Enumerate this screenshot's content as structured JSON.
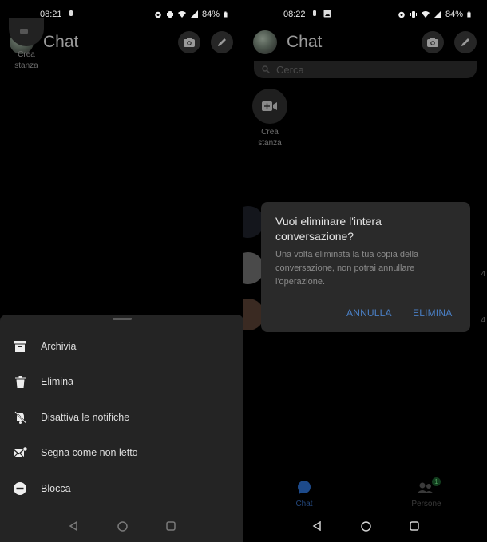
{
  "left_screen": {
    "status_bar": {
      "time": "08:21",
      "battery": "84%"
    },
    "header": {
      "title": "Chat"
    },
    "create_room": {
      "line1": "Crea",
      "line2": "stanza"
    },
    "sheet": {
      "items": [
        {
          "label": "Archivia",
          "icon": "archive-icon"
        },
        {
          "label": "Elimina",
          "icon": "trash-icon"
        },
        {
          "label": "Disattiva le notifiche",
          "icon": "bell-off-icon"
        },
        {
          "label": "Segna come non letto",
          "icon": "mark-unread-icon"
        },
        {
          "label": "Blocca",
          "icon": "block-icon"
        }
      ]
    }
  },
  "right_screen": {
    "status_bar": {
      "time": "08:22",
      "battery": "84%"
    },
    "header": {
      "title": "Chat"
    },
    "search": {
      "placeholder": "Cerca"
    },
    "create_room": {
      "line1": "Crea",
      "line2": "stanza"
    },
    "dialog": {
      "title": "Vuoi eliminare l'intera conversazione?",
      "body": "Una volta eliminata la tua copia della conversazione, non potrai annullare l'operazione.",
      "cancel": "ANNULLA",
      "confirm": "ELIMINA"
    },
    "ghost_times": [
      "4",
      "4"
    ],
    "tabs": [
      {
        "label": "Chat",
        "active": true
      },
      {
        "label": "Persone",
        "badge": "1"
      }
    ]
  },
  "colors": {
    "accent_blue": "#4a7fc4",
    "sheet_bg": "#242424",
    "dialog_bg": "#2a2a2a",
    "badge_green": "#1f7a36"
  }
}
